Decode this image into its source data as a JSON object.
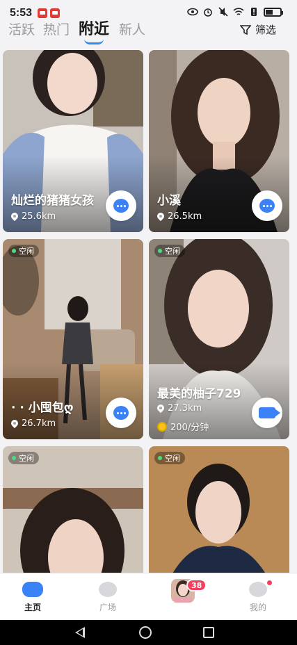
{
  "status_bar": {
    "time": "5:53"
  },
  "tabs": [
    {
      "label": "活跃"
    },
    {
      "label": "热门"
    },
    {
      "label": "附近",
      "active": true
    },
    {
      "label": "新人"
    }
  ],
  "filter": {
    "label": "筛选"
  },
  "cards": [
    {
      "name": "灿烂的猪猪女孩",
      "distance": "25.6km",
      "action": "chat"
    },
    {
      "name": "小溪",
      "distance": "26.5km",
      "action": "chat"
    },
    {
      "status": "空闲",
      "name": "· · 小囤包ღ",
      "distance": "26.7km",
      "action": "chat"
    },
    {
      "status": "空闲",
      "name": "最美的柚子729",
      "distance": "27.3km",
      "price": "200/分钟",
      "action": "video"
    },
    {
      "status": "空闲"
    },
    {
      "status": "空闲"
    }
  ],
  "bottom_nav": {
    "home": "主页",
    "square": "广场",
    "messages_badge": "38",
    "mine": "我的"
  },
  "colors": {
    "accent": "#3b82f6",
    "badge": "#f43f5e",
    "online": "#4ade80"
  }
}
